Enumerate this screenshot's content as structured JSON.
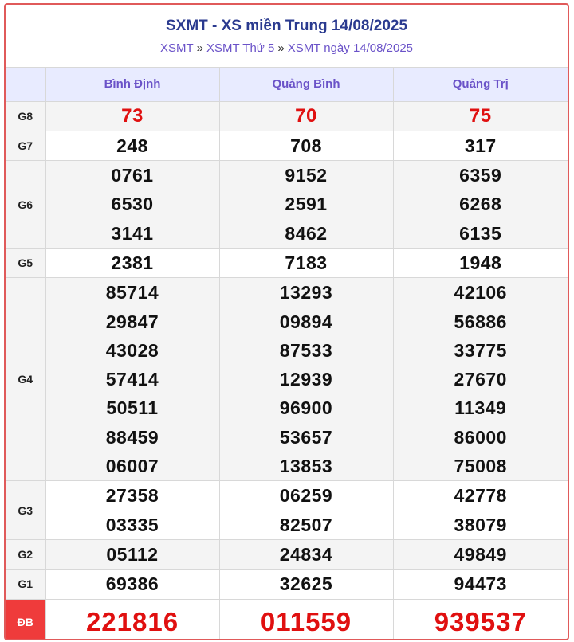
{
  "header": {
    "title": "SXMT - XS miền Trung 14/08/2025",
    "breadcrumb": [
      {
        "label": "XSMT"
      },
      {
        "label": "XSMT Thứ 5"
      },
      {
        "label": "XSMT ngày 14/08/2025"
      }
    ],
    "separator": "»"
  },
  "provinces": [
    "Bình Định",
    "Quảng Bình",
    "Quảng Trị"
  ],
  "prizes": [
    {
      "label": "G8",
      "values": [
        [
          "73"
        ],
        [
          "70"
        ],
        [
          "75"
        ]
      ]
    },
    {
      "label": "G7",
      "values": [
        [
          "248"
        ],
        [
          "708"
        ],
        [
          "317"
        ]
      ]
    },
    {
      "label": "G6",
      "values": [
        [
          "0761",
          "6530",
          "3141"
        ],
        [
          "9152",
          "2591",
          "8462"
        ],
        [
          "6359",
          "6268",
          "6135"
        ]
      ]
    },
    {
      "label": "G5",
      "values": [
        [
          "2381"
        ],
        [
          "7183"
        ],
        [
          "1948"
        ]
      ]
    },
    {
      "label": "G4",
      "values": [
        [
          "85714",
          "29847",
          "43028",
          "57414",
          "50511",
          "88459",
          "06007"
        ],
        [
          "13293",
          "09894",
          "87533",
          "12939",
          "96900",
          "53657",
          "13853"
        ],
        [
          "42106",
          "56886",
          "33775",
          "27670",
          "11349",
          "86000",
          "75008"
        ]
      ]
    },
    {
      "label": "G3",
      "values": [
        [
          "27358",
          "03335"
        ],
        [
          "06259",
          "82507"
        ],
        [
          "42778",
          "38079"
        ]
      ]
    },
    {
      "label": "G2",
      "values": [
        [
          "05112"
        ],
        [
          "24834"
        ],
        [
          "49849"
        ]
      ]
    },
    {
      "label": "G1",
      "values": [
        [
          "69386"
        ],
        [
          "32625"
        ],
        [
          "94473"
        ]
      ]
    },
    {
      "label": "ĐB",
      "values": [
        [
          "221816"
        ],
        [
          "011559"
        ],
        [
          "939537"
        ]
      ]
    }
  ],
  "colors": {
    "accent": "#2a3a8f",
    "link": "#6a52c8",
    "special": "#e01010",
    "special_bg": "#ef3b3b",
    "border": "#e05a5a"
  }
}
